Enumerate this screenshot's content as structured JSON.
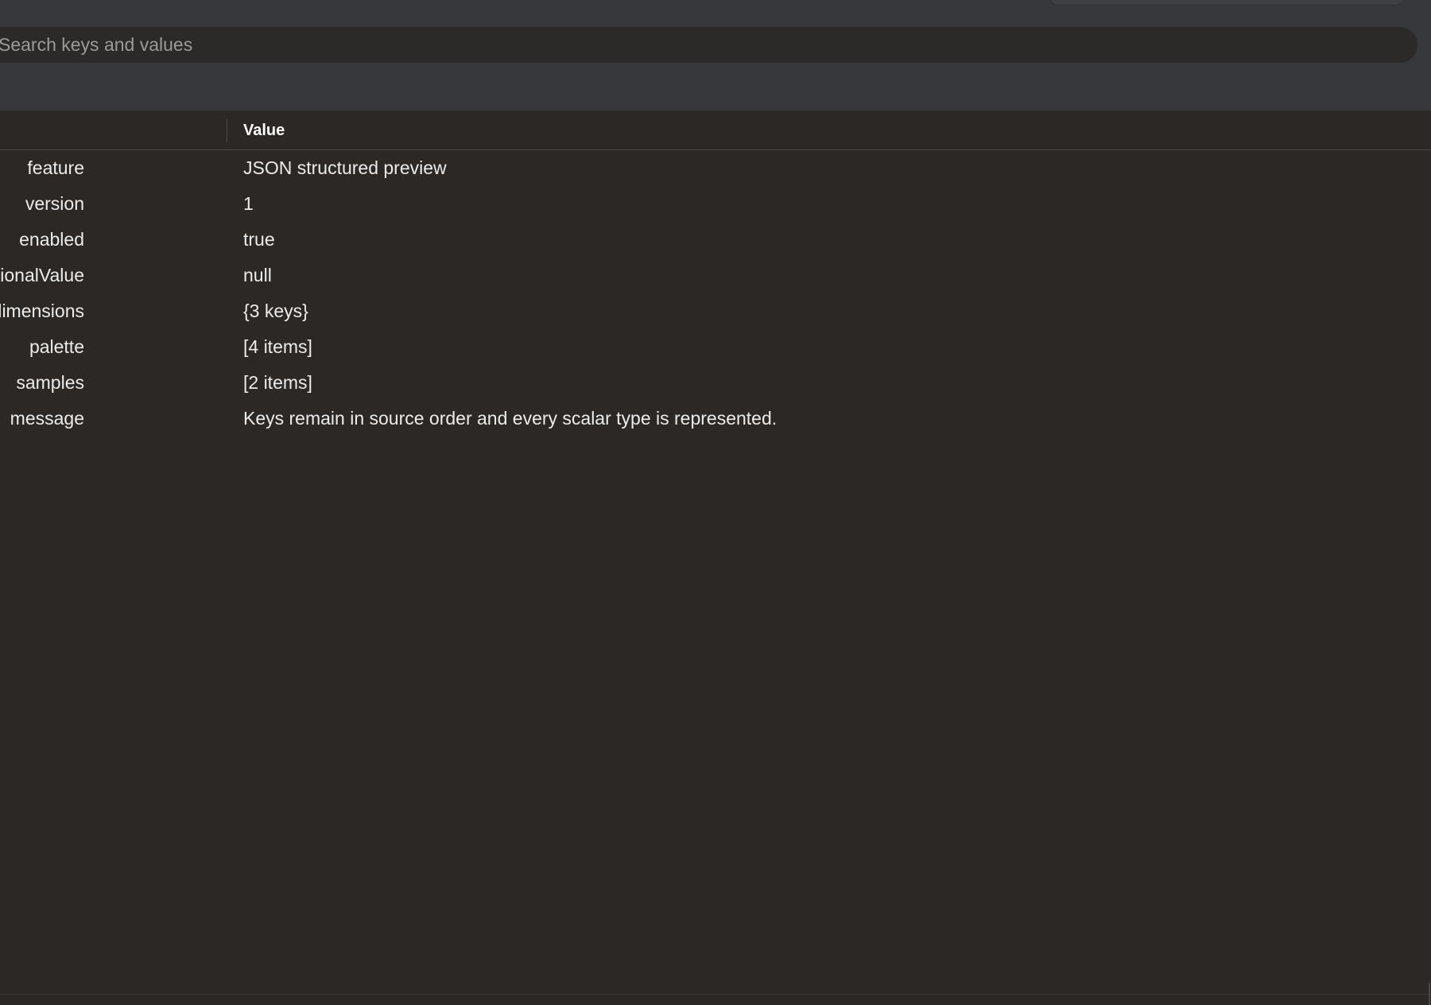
{
  "search": {
    "placeholder": "Search keys and values",
    "value": ""
  },
  "table": {
    "key_header": "",
    "value_header": "Value",
    "rows": [
      {
        "key": "feature",
        "value": "JSON structured preview"
      },
      {
        "key": "version",
        "value": "1"
      },
      {
        "key": "enabled",
        "value": "true"
      },
      {
        "key": "optionalValue",
        "value": "null"
      },
      {
        "key": "dimensions",
        "value": "{3 keys}"
      },
      {
        "key": "palette",
        "value": "[4 items]"
      },
      {
        "key": "samples",
        "value": "[2 items]"
      },
      {
        "key": "message",
        "value": "Keys remain in source order and every scalar type is represented."
      }
    ]
  },
  "colors": {
    "toolbar_bg": "#36383b",
    "content_bg": "#2b2826",
    "search_bg": "#2b2a29",
    "text": "#ececec",
    "placeholder": "#9a9a9a"
  }
}
